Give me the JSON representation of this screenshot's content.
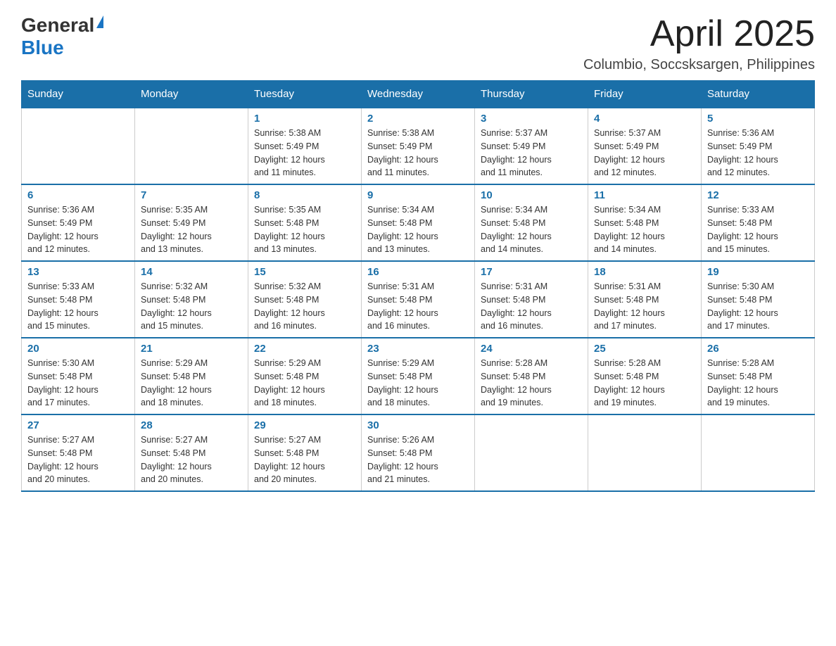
{
  "header": {
    "logo_general": "General",
    "logo_blue": "Blue",
    "title": "April 2025",
    "subtitle": "Columbio, Soccsksargen, Philippines"
  },
  "days_of_week": [
    "Sunday",
    "Monday",
    "Tuesday",
    "Wednesday",
    "Thursday",
    "Friday",
    "Saturday"
  ],
  "weeks": [
    [
      {
        "day": "",
        "info": ""
      },
      {
        "day": "",
        "info": ""
      },
      {
        "day": "1",
        "info": "Sunrise: 5:38 AM\nSunset: 5:49 PM\nDaylight: 12 hours\nand 11 minutes."
      },
      {
        "day": "2",
        "info": "Sunrise: 5:38 AM\nSunset: 5:49 PM\nDaylight: 12 hours\nand 11 minutes."
      },
      {
        "day": "3",
        "info": "Sunrise: 5:37 AM\nSunset: 5:49 PM\nDaylight: 12 hours\nand 11 minutes."
      },
      {
        "day": "4",
        "info": "Sunrise: 5:37 AM\nSunset: 5:49 PM\nDaylight: 12 hours\nand 12 minutes."
      },
      {
        "day": "5",
        "info": "Sunrise: 5:36 AM\nSunset: 5:49 PM\nDaylight: 12 hours\nand 12 minutes."
      }
    ],
    [
      {
        "day": "6",
        "info": "Sunrise: 5:36 AM\nSunset: 5:49 PM\nDaylight: 12 hours\nand 12 minutes."
      },
      {
        "day": "7",
        "info": "Sunrise: 5:35 AM\nSunset: 5:49 PM\nDaylight: 12 hours\nand 13 minutes."
      },
      {
        "day": "8",
        "info": "Sunrise: 5:35 AM\nSunset: 5:48 PM\nDaylight: 12 hours\nand 13 minutes."
      },
      {
        "day": "9",
        "info": "Sunrise: 5:34 AM\nSunset: 5:48 PM\nDaylight: 12 hours\nand 13 minutes."
      },
      {
        "day": "10",
        "info": "Sunrise: 5:34 AM\nSunset: 5:48 PM\nDaylight: 12 hours\nand 14 minutes."
      },
      {
        "day": "11",
        "info": "Sunrise: 5:34 AM\nSunset: 5:48 PM\nDaylight: 12 hours\nand 14 minutes."
      },
      {
        "day": "12",
        "info": "Sunrise: 5:33 AM\nSunset: 5:48 PM\nDaylight: 12 hours\nand 15 minutes."
      }
    ],
    [
      {
        "day": "13",
        "info": "Sunrise: 5:33 AM\nSunset: 5:48 PM\nDaylight: 12 hours\nand 15 minutes."
      },
      {
        "day": "14",
        "info": "Sunrise: 5:32 AM\nSunset: 5:48 PM\nDaylight: 12 hours\nand 15 minutes."
      },
      {
        "day": "15",
        "info": "Sunrise: 5:32 AM\nSunset: 5:48 PM\nDaylight: 12 hours\nand 16 minutes."
      },
      {
        "day": "16",
        "info": "Sunrise: 5:31 AM\nSunset: 5:48 PM\nDaylight: 12 hours\nand 16 minutes."
      },
      {
        "day": "17",
        "info": "Sunrise: 5:31 AM\nSunset: 5:48 PM\nDaylight: 12 hours\nand 16 minutes."
      },
      {
        "day": "18",
        "info": "Sunrise: 5:31 AM\nSunset: 5:48 PM\nDaylight: 12 hours\nand 17 minutes."
      },
      {
        "day": "19",
        "info": "Sunrise: 5:30 AM\nSunset: 5:48 PM\nDaylight: 12 hours\nand 17 minutes."
      }
    ],
    [
      {
        "day": "20",
        "info": "Sunrise: 5:30 AM\nSunset: 5:48 PM\nDaylight: 12 hours\nand 17 minutes."
      },
      {
        "day": "21",
        "info": "Sunrise: 5:29 AM\nSunset: 5:48 PM\nDaylight: 12 hours\nand 18 minutes."
      },
      {
        "day": "22",
        "info": "Sunrise: 5:29 AM\nSunset: 5:48 PM\nDaylight: 12 hours\nand 18 minutes."
      },
      {
        "day": "23",
        "info": "Sunrise: 5:29 AM\nSunset: 5:48 PM\nDaylight: 12 hours\nand 18 minutes."
      },
      {
        "day": "24",
        "info": "Sunrise: 5:28 AM\nSunset: 5:48 PM\nDaylight: 12 hours\nand 19 minutes."
      },
      {
        "day": "25",
        "info": "Sunrise: 5:28 AM\nSunset: 5:48 PM\nDaylight: 12 hours\nand 19 minutes."
      },
      {
        "day": "26",
        "info": "Sunrise: 5:28 AM\nSunset: 5:48 PM\nDaylight: 12 hours\nand 19 minutes."
      }
    ],
    [
      {
        "day": "27",
        "info": "Sunrise: 5:27 AM\nSunset: 5:48 PM\nDaylight: 12 hours\nand 20 minutes."
      },
      {
        "day": "28",
        "info": "Sunrise: 5:27 AM\nSunset: 5:48 PM\nDaylight: 12 hours\nand 20 minutes."
      },
      {
        "day": "29",
        "info": "Sunrise: 5:27 AM\nSunset: 5:48 PM\nDaylight: 12 hours\nand 20 minutes."
      },
      {
        "day": "30",
        "info": "Sunrise: 5:26 AM\nSunset: 5:48 PM\nDaylight: 12 hours\nand 21 minutes."
      },
      {
        "day": "",
        "info": ""
      },
      {
        "day": "",
        "info": ""
      },
      {
        "day": "",
        "info": ""
      }
    ]
  ]
}
